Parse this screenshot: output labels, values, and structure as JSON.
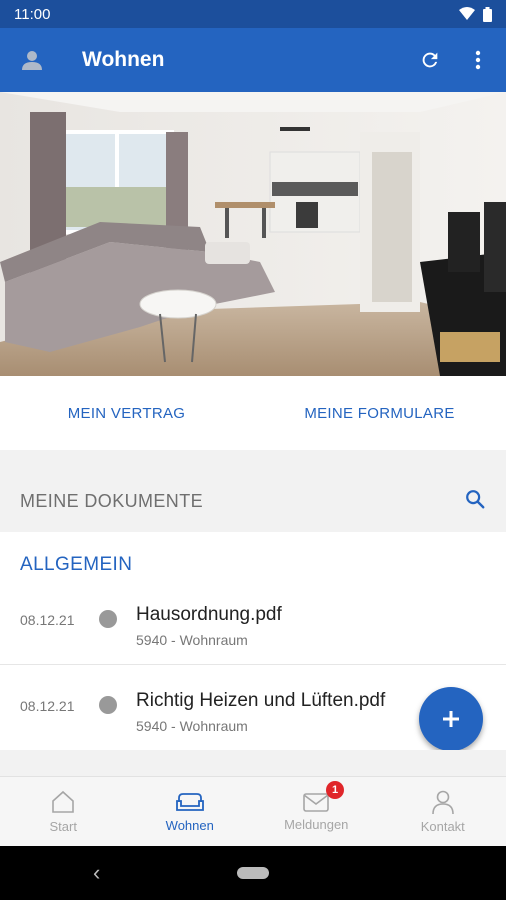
{
  "status_bar": {
    "time": "11:00"
  },
  "app_bar": {
    "title": "Wohnen"
  },
  "hero": {
    "alt": "Wohnzimmer mit Sofa und Küche"
  },
  "links": {
    "contract": "MEIN VERTRAG",
    "forms": "MEINE FORMULARE"
  },
  "documents": {
    "header": "MEINE DOKUMENTE",
    "section": "ALLGEMEIN",
    "items": [
      {
        "date": "08.12.21",
        "name": "Hausordnung.pdf",
        "sub": "5940 - Wohnraum"
      },
      {
        "date": "08.12.21",
        "name": "Richtig Heizen und Lüften.pdf",
        "sub": "5940 - Wohnraum"
      }
    ]
  },
  "bottom_nav": {
    "items": [
      {
        "label": "Start",
        "icon": "home-icon"
      },
      {
        "label": "Wohnen",
        "icon": "sofa-icon"
      },
      {
        "label": "Meldungen",
        "icon": "mail-icon",
        "badge": "1"
      },
      {
        "label": "Kontakt",
        "icon": "person-icon"
      }
    ]
  },
  "colors": {
    "primary": "#2464c0",
    "status_bar": "#1c4f9c",
    "badge": "#e0262a"
  }
}
